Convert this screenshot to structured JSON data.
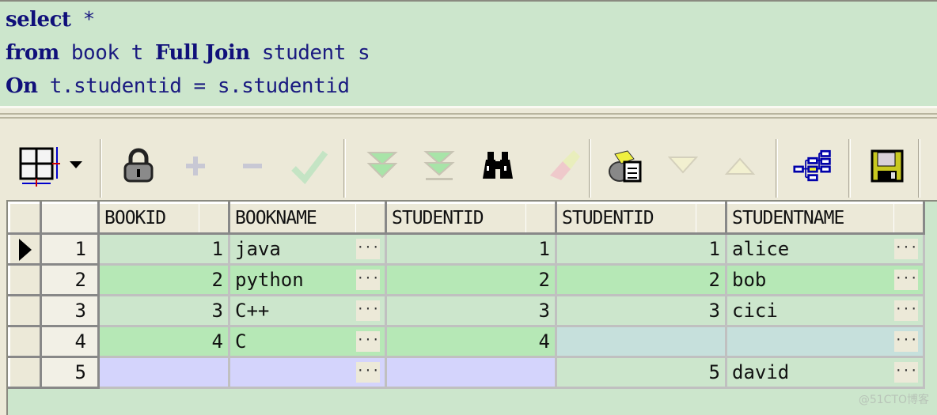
{
  "sql_editor": {
    "lines": [
      [
        {
          "t": "select",
          "kw": true
        },
        {
          "t": " *",
          "kw": false
        }
      ],
      [
        {
          "t": "from",
          "kw": true
        },
        {
          "t": " book t ",
          "kw": false
        },
        {
          "t": "Full Join",
          "kw": true
        },
        {
          "t": " student s",
          "kw": false
        }
      ],
      [
        {
          "t": "On",
          "kw": true
        },
        {
          "t": " t.studentid = s.studentid",
          "kw": false
        }
      ]
    ]
  },
  "toolbar": {
    "buttons": [
      {
        "name": "grid-options-button",
        "icon": "grid-icon",
        "enabled": true
      },
      {
        "name": "lock-button",
        "icon": "lock-icon",
        "enabled": true
      },
      {
        "name": "insert-record-button",
        "icon": "plus-icon",
        "enabled": false
      },
      {
        "name": "delete-record-button",
        "icon": "minus-icon",
        "enabled": false
      },
      {
        "name": "post-changes-button",
        "icon": "checkmark-icon",
        "enabled": false
      },
      {
        "name": "next-page-button",
        "icon": "double-chevron-down-icon",
        "enabled": false
      },
      {
        "name": "last-page-button",
        "icon": "double-chevron-down-bar-icon",
        "enabled": false
      },
      {
        "name": "find-button",
        "icon": "binoculars-icon",
        "enabled": true
      },
      {
        "name": "clear-button",
        "icon": "eraser-icon",
        "enabled": false
      },
      {
        "name": "query-by-example-button",
        "icon": "records-document-icon",
        "enabled": true
      },
      {
        "name": "next-record-button",
        "icon": "triangle-down-icon",
        "enabled": false
      },
      {
        "name": "previous-record-button",
        "icon": "triangle-up-icon",
        "enabled": false
      },
      {
        "name": "explain-plan-button",
        "icon": "tree-icon",
        "enabled": true
      },
      {
        "name": "save-button",
        "icon": "floppy-disk-icon",
        "enabled": true
      }
    ]
  },
  "grid": {
    "columns": [
      "BOOKID",
      "BOOKNAME",
      "STUDENTID",
      "STUDENTID",
      "STUDENTNAME"
    ],
    "current_row": 1,
    "rows": [
      {
        "num": "1",
        "bookid": "1",
        "bookname": "java",
        "t_studentid": "1",
        "s_studentid": "1",
        "studentname": "alice"
      },
      {
        "num": "2",
        "bookid": "2",
        "bookname": "python",
        "t_studentid": "2",
        "s_studentid": "2",
        "studentname": "bob"
      },
      {
        "num": "3",
        "bookid": "3",
        "bookname": "C++",
        "t_studentid": "3",
        "s_studentid": "3",
        "studentname": "cici"
      },
      {
        "num": "4",
        "bookid": "4",
        "bookname": "C",
        "t_studentid": "4",
        "s_studentid": "",
        "studentname": ""
      },
      {
        "num": "5",
        "bookid": "",
        "bookname": "",
        "t_studentid": "",
        "s_studentid": "5",
        "studentname": "david"
      }
    ],
    "ellipsis_label": "..."
  },
  "watermark": "@51CTO博客"
}
